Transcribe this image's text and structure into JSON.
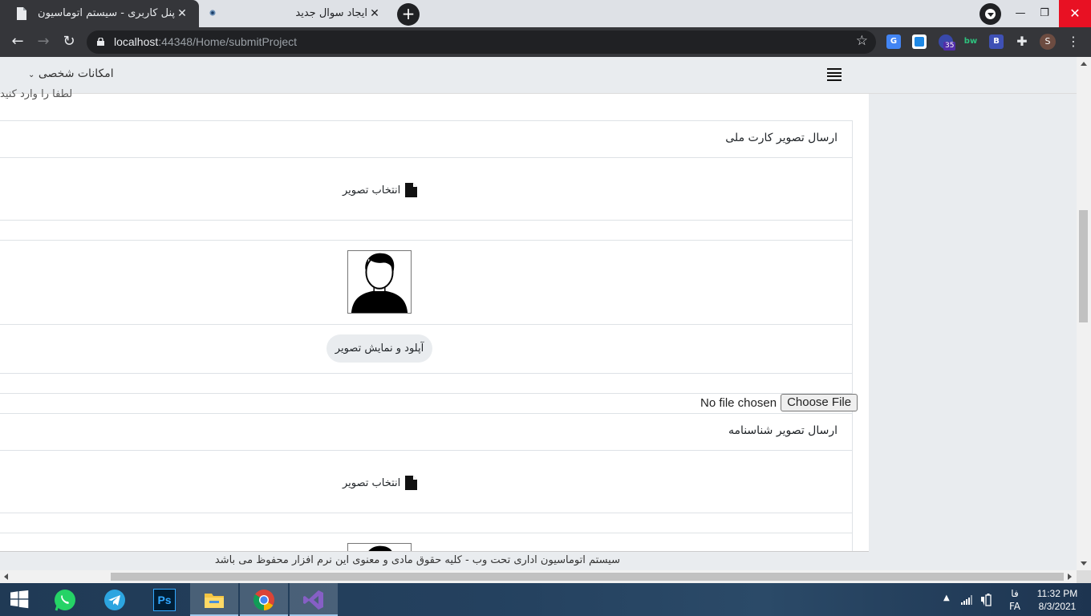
{
  "browser": {
    "tabs": [
      {
        "title": "پنل کاربری - سیستم اتوماسیون اداری",
        "active": true
      },
      {
        "title": "ایجاد سوال جدید",
        "active": false
      }
    ],
    "new_tab_label": "+",
    "url_host": "localhost",
    "url_rest": ":44348/Home/submitProject",
    "extensions": [
      "google-translate-icon",
      "ext-icon",
      "ext-badge-35",
      "bw-icon",
      "b-icon",
      "puzzle-icon"
    ],
    "extension_badge": "35",
    "extension_bw_label": "bw",
    "extension_b_label": "B",
    "avatar_letter": "S"
  },
  "navbar": {
    "personal_menu": "امکانات شخصی"
  },
  "page": {
    "cutoff_text": "لطفا را وارد کنید",
    "sections": [
      {
        "title": "ارسال تصویر کارت ملی",
        "select_label": "انتخاب تصویر",
        "upload_label": "آپلود و نمایش تصویر"
      },
      {
        "title": "ارسال تصویر شناسنامه",
        "select_label": "انتخاب تصویر"
      }
    ],
    "file_input": {
      "button": "Choose File",
      "status": "No file chosen"
    },
    "footer": "سیستم اتوماسیون اداری تحت وب - کلیه حقوق مادی و معنوی این نرم افزار محفوظ می باشد"
  },
  "taskbar": {
    "apps": [
      "windows-start-icon",
      "whatsapp-icon",
      "telegram-icon",
      "photoshop-icon",
      "file-explorer-icon",
      "chrome-icon",
      "visual-studio-icon"
    ],
    "photoshop_label": "Ps",
    "lang_top": "فا",
    "lang_bottom": "FA",
    "time": "11:32 PM",
    "date": "8/3/2021"
  },
  "colors": {
    "tab_active_bg": "#35363a",
    "toolbar_bg": "#35363a",
    "navbar_bg": "#e9ecef",
    "taskbar_bg": "#24415f"
  }
}
